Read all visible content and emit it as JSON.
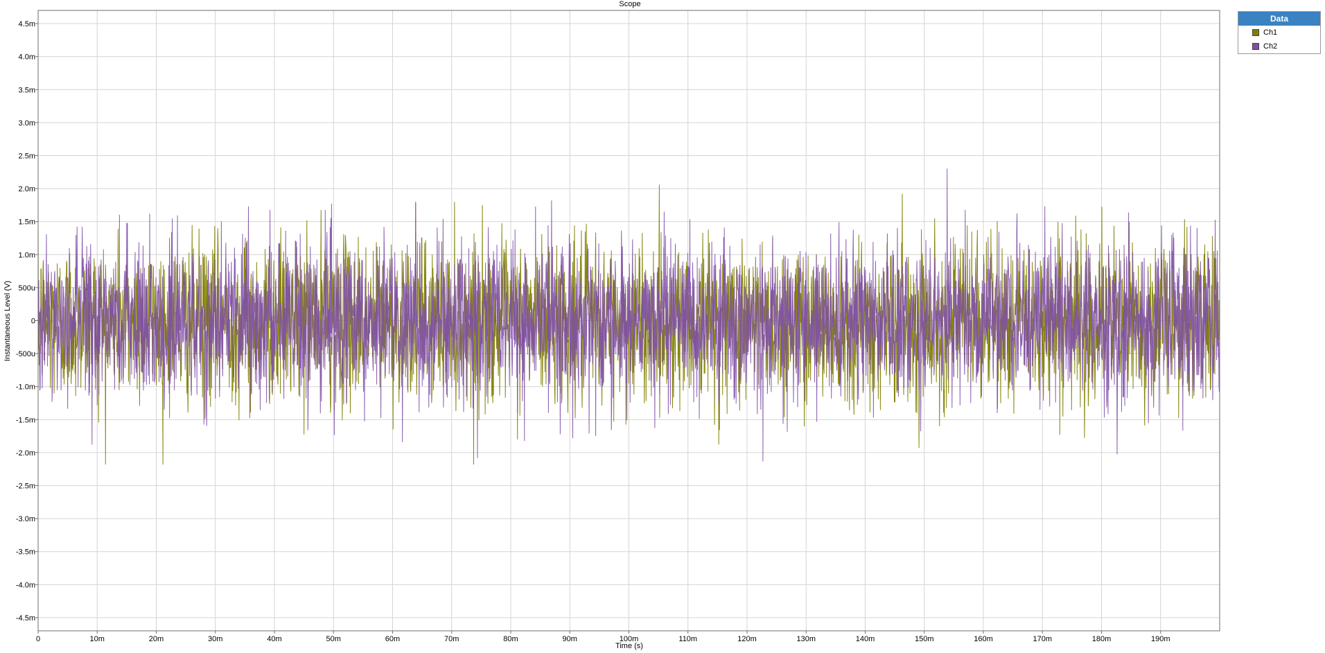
{
  "chart_data": {
    "type": "line",
    "title": "Scope",
    "xlabel": "Time (s)",
    "ylabel": "Instantaneous Level (V)",
    "xlim": [
      0,
      0.2
    ],
    "ylim": [
      -0.0047,
      0.0047
    ],
    "grid": true,
    "legend_position": "top-right, outside plot",
    "x_ticks": [
      {
        "value": 0,
        "label": "0"
      },
      {
        "value": 0.01,
        "label": "10m"
      },
      {
        "value": 0.02,
        "label": "20m"
      },
      {
        "value": 0.03,
        "label": "30m"
      },
      {
        "value": 0.04,
        "label": "40m"
      },
      {
        "value": 0.05,
        "label": "50m"
      },
      {
        "value": 0.06,
        "label": "60m"
      },
      {
        "value": 0.07,
        "label": "70m"
      },
      {
        "value": 0.08,
        "label": "80m"
      },
      {
        "value": 0.09,
        "label": "90m"
      },
      {
        "value": 0.1,
        "label": "100m"
      },
      {
        "value": 0.11,
        "label": "110m"
      },
      {
        "value": 0.12,
        "label": "120m"
      },
      {
        "value": 0.13,
        "label": "130m"
      },
      {
        "value": 0.14,
        "label": "140m"
      },
      {
        "value": 0.15,
        "label": "150m"
      },
      {
        "value": 0.16,
        "label": "160m"
      },
      {
        "value": 0.17,
        "label": "170m"
      },
      {
        "value": 0.18,
        "label": "180m"
      },
      {
        "value": 0.19,
        "label": "190m"
      }
    ],
    "y_ticks": [
      {
        "value": 0.0045,
        "label": "4.5m"
      },
      {
        "value": 0.004,
        "label": "4.0m"
      },
      {
        "value": 0.0035,
        "label": "3.5m"
      },
      {
        "value": 0.003,
        "label": "3.0m"
      },
      {
        "value": 0.0025,
        "label": "2.5m"
      },
      {
        "value": 0.002,
        "label": "2.0m"
      },
      {
        "value": 0.0015,
        "label": "1.5m"
      },
      {
        "value": 0.001,
        "label": "1.0m"
      },
      {
        "value": 0.0005,
        "label": "500u"
      },
      {
        "value": 0,
        "label": "0"
      },
      {
        "value": -0.0005,
        "label": "-500u"
      },
      {
        "value": -0.001,
        "label": "-1.0m"
      },
      {
        "value": -0.0015,
        "label": "-1.5m"
      },
      {
        "value": -0.002,
        "label": "-2.0m"
      },
      {
        "value": -0.0025,
        "label": "-2.5m"
      },
      {
        "value": -0.003,
        "label": "-3.0m"
      },
      {
        "value": -0.0035,
        "label": "-3.5m"
      },
      {
        "value": -0.004,
        "label": "-4.0m"
      },
      {
        "value": -0.0045,
        "label": "-4.5m"
      }
    ],
    "series": [
      {
        "name": "Ch1",
        "color": "#808000",
        "approx_rms": 0.0006,
        "approx_peak_max": 0.00257,
        "approx_peak_min": -0.00218
      },
      {
        "name": "Ch2",
        "color": "#7f4fa8",
        "approx_rms": 0.0006,
        "approx_peak_max": 0.0027,
        "approx_peak_min": -0.00232
      }
    ]
  },
  "legend": {
    "title": "Data",
    "items": [
      {
        "label": "Ch1",
        "color": "#808000"
      },
      {
        "label": "Ch2",
        "color": "#7f4fa8"
      }
    ]
  },
  "colors": {
    "grid": "#d4d4d4",
    "axis": "#6e6e6e",
    "legend_header": "#3a82c2"
  }
}
